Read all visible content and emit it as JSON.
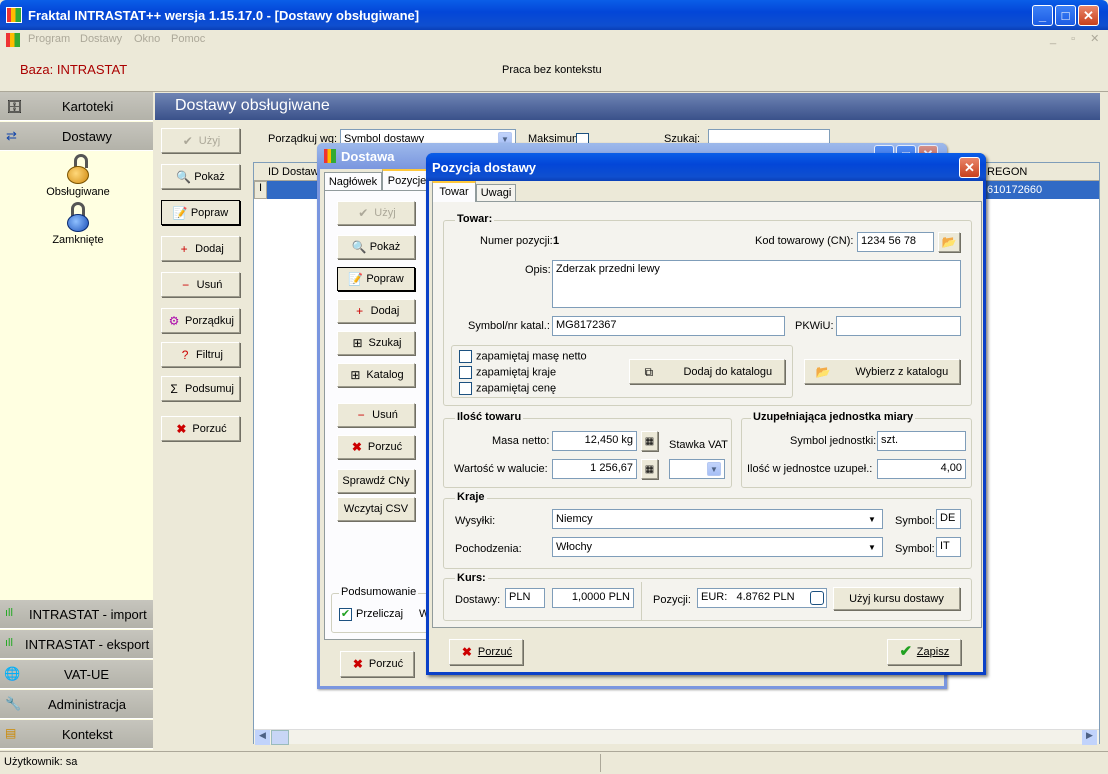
{
  "main_window": {
    "title": "Fraktal INTRASTAT++   wersja 1.15.17.0 - [Dostawy obsługiwane]",
    "menu": [
      "Program",
      "Dostawy",
      "Okno",
      "Pomoc"
    ],
    "baza": "Baza: INTRASTAT",
    "context": "Praca bez kontekstu",
    "status_user": "Użytkownik: sa"
  },
  "sidebar": {
    "top": [
      {
        "label": "Kartoteki"
      },
      {
        "label": "Dostawy"
      }
    ],
    "items": [
      {
        "label": "Obsługiwane",
        "icon": "unlocked-padlock-icon"
      },
      {
        "label": "Zamknięte",
        "icon": "locked-padlock-icon"
      }
    ],
    "bottom": [
      {
        "label": "INTRASTAT - import"
      },
      {
        "label": "INTRASTAT - eksport"
      },
      {
        "label": "VAT-UE"
      },
      {
        "label": "Administracja"
      },
      {
        "label": "Kontekst"
      }
    ]
  },
  "panel": {
    "title": "Dostawy obsługiwane",
    "buttons": [
      "Użyj",
      "Pokaż",
      "Popraw",
      "Dodaj",
      "Usuń",
      "Porządkuj",
      "Filtruj",
      "Podsumuj",
      "Porzuć"
    ],
    "sort_label": "Porządkuj wg:",
    "sort_value": "Symbol dostawy",
    "mask_label": "Maksimum:",
    "search_label": "Szukaj:",
    "col_id": "ID Dostaw",
    "col_regon": "REGON",
    "row_regon": "610172660"
  },
  "dostawa": {
    "title": "Dostawa",
    "tabs": [
      "Nagłówek",
      "Pozycje"
    ],
    "buttons": [
      "Użyj",
      "Pokaż",
      "Popraw",
      "Dodaj",
      "Szukaj",
      "Katalog",
      "Usuń",
      "Porzuć",
      "Sprawdź CNy",
      "Wczytaj CSV"
    ],
    "summary_title": "Podsumowanie",
    "recalc": "Przeliczaj",
    "recalc_w": "W",
    "porzuc": "Porzuć"
  },
  "pozycja": {
    "title": "Pozycja dostawy",
    "tabs": [
      "Towar",
      "Uwagi"
    ],
    "towar": {
      "title": "Towar:",
      "numer_label": "Numer pozycji:",
      "numer": "1",
      "kod_label": "Kod towarowy (CN):",
      "kod": "1234 56 78",
      "opis_label": "Opis:",
      "opis": "Zderzak przedni lewy",
      "symbol_label": "Symbol/nr katal.:",
      "symbol": "MG8172367",
      "pkwiu_label": "PKWiU:",
      "pkwiu": "",
      "remember": [
        "zapamiętaj masę netto",
        "zapamiętaj kraje",
        "zapamiętaj cenę"
      ],
      "dodaj_kat": "Dodaj do katalogu",
      "wybierz_kat": "Wybierz z katalogu"
    },
    "ilosc": {
      "title": "Ilość towaru",
      "masa_label": "Masa netto:",
      "masa": "12,450 kg",
      "wartosc_label": "Wartość w walucie:",
      "wartosc": "1 256,67",
      "vat_label": "Stawka VAT",
      "vat": ""
    },
    "uzup": {
      "title": "Uzupełniająca jednostka miary",
      "symbol_label": "Symbol jednostki:",
      "symbol": "szt.",
      "ilosc_label": "Ilość w jednostce uzupeł.:",
      "ilosc": "4,00"
    },
    "kraje": {
      "title": "Kraje",
      "wysylki_label": "Wysyłki:",
      "wysylki": "Niemcy",
      "pochodzenia_label": "Pochodzenia:",
      "pochodzenia": "Włochy",
      "symbol_label": "Symbol:",
      "wysylki_sym": "DE",
      "pochodzenia_sym": "IT"
    },
    "kurs": {
      "title": "Kurs:",
      "dostawy_label": "Dostawy:",
      "waluta": "PLN",
      "kurs": "1,0000 PLN",
      "pozycji_label": "Pozycji:",
      "pozycji": "EUR:   4.8762 PLN",
      "uzyj_kursu": "Użyj kursu dostawy"
    },
    "porzuc": "Porzuć",
    "zapisz": "Zapisz"
  }
}
